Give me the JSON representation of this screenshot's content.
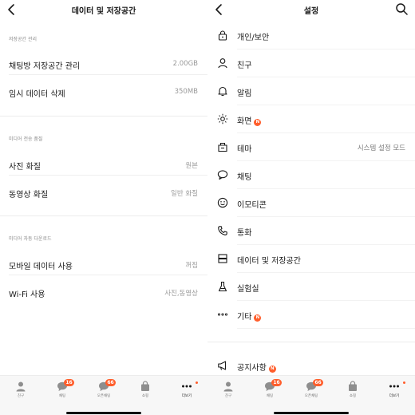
{
  "left": {
    "title": "데이터 및 저장공간",
    "sections": [
      {
        "label": "저장공간 관리",
        "rows": [
          {
            "label": "채팅방 저장공간 관리",
            "value": "2.00GB"
          },
          {
            "label": "임시 데이터 삭제",
            "value": "350MB"
          }
        ]
      },
      {
        "label": "미디어 전송 품질",
        "rows": [
          {
            "label": "사진 화질",
            "value": "원본"
          },
          {
            "label": "동영상 화질",
            "value": "일반 화질"
          }
        ]
      },
      {
        "label": "미디어 자동 다운로드",
        "rows": [
          {
            "label": "모바일 데이터 사용",
            "value": "꺼짐"
          },
          {
            "label": "Wi-Fi 사용",
            "value": "사진,동영상"
          }
        ]
      }
    ]
  },
  "right": {
    "title": "설정",
    "items": [
      {
        "icon": "lock-icon",
        "label": "개인/보안"
      },
      {
        "icon": "person-icon",
        "label": "친구"
      },
      {
        "icon": "bell-icon",
        "label": "알림"
      },
      {
        "icon": "brightness-icon",
        "label": "화면",
        "badge": "N"
      },
      {
        "icon": "theme-icon",
        "label": "테마",
        "value": "시스템 설정 모드"
      },
      {
        "icon": "chat-bubble-icon",
        "label": "채팅"
      },
      {
        "icon": "emoticon-icon",
        "label": "이모티콘"
      },
      {
        "icon": "phone-icon",
        "label": "통화"
      },
      {
        "icon": "storage-icon",
        "label": "데이터 및 저장공간"
      },
      {
        "icon": "flask-icon",
        "label": "실험실"
      },
      {
        "icon": "more-dots-icon",
        "label": "기타",
        "badge": "N"
      }
    ],
    "notice": {
      "icon": "megaphone-icon",
      "label": "공지사항",
      "badge": "N"
    }
  },
  "tabbar": {
    "tabs": [
      {
        "label": "친구",
        "icon": "person-icon"
      },
      {
        "label": "채팅",
        "icon": "chat-icon",
        "badge": "16"
      },
      {
        "label": "오픈채팅",
        "icon": "open-chat-icon",
        "badge": "66"
      },
      {
        "label": "쇼핑",
        "icon": "shopping-bag-icon"
      },
      {
        "label": "더보기",
        "icon": "more-icon",
        "active": true
      }
    ]
  },
  "colors": {
    "accent": "#ff5e2c",
    "text": "#191919",
    "secondary": "#9a9a9a"
  }
}
